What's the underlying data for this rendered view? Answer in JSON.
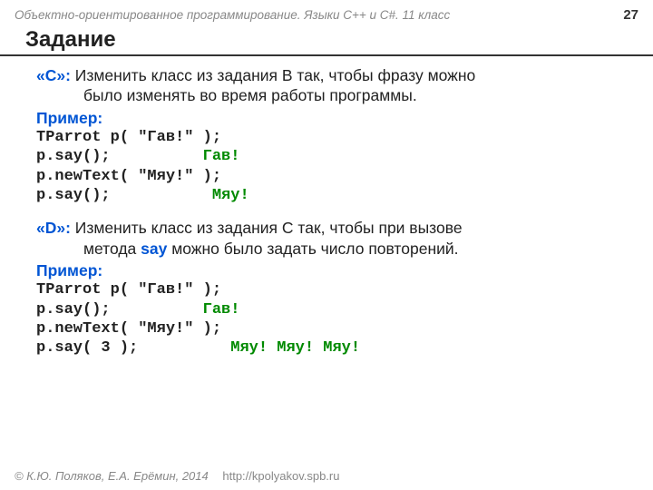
{
  "header": {
    "subtitle": "Объектно-ориентированное программирование. Языки C++ и C#. 11 класс",
    "page_number": "27"
  },
  "title": "Задание",
  "taskC": {
    "label": "«C»:",
    "text_line1": " Изменить класс из задания B так, чтобы фразу можно",
    "text_line2": "было изменять во время работы программы.",
    "example_label": "Пример:",
    "code1": "TParrot p( \"Гав!\" );",
    "code2": "p.say();          ",
    "out2": "Гав!",
    "code3": "p.newText( \"Мяу!\" );",
    "code4": "p.say();           ",
    "out4": "Мяу!"
  },
  "taskD": {
    "label": "«D»:",
    "text_line1": " Изменить класс из задания C так, чтобы при вызове",
    "text_line2_a": "метода ",
    "say_word": "say",
    "text_line2_b": "  можно было задать число повторений.",
    "example_label": "Пример:",
    "code1": "TParrot p( \"Гав!\" );",
    "code2": "p.say();          ",
    "out2": "Гав!",
    "code3": "p.newText( \"Мяу!\" );",
    "code4": "p.say( 3 );          ",
    "out4": "Мяу! Мяу! Мяу!"
  },
  "footer": {
    "copyright": "© К.Ю. Поляков, Е.А. Ерёмин, 2014",
    "url": "http://kpolyakov.spb.ru"
  }
}
